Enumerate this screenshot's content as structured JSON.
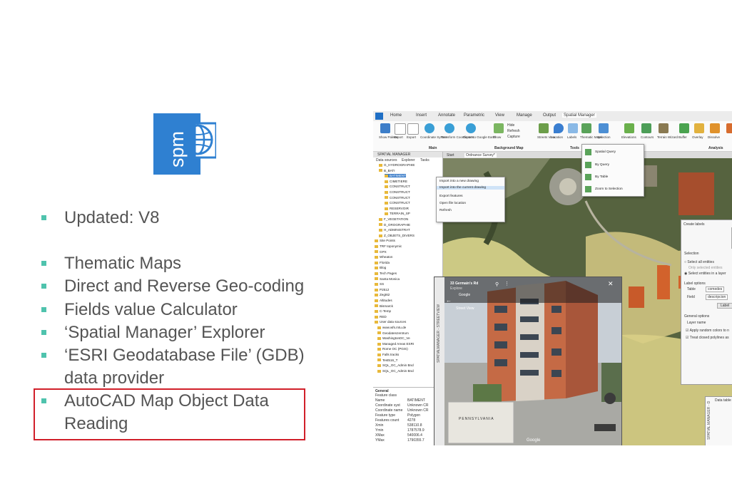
{
  "logo": {
    "text": "spm",
    "icon": "globe-icon",
    "color": "#2f80d1"
  },
  "bullets": [
    "Updated: V8",
    "Thematic Maps",
    "Direct and Reverse Geo-coding",
    "Fields value Calculator",
    "‘Spatial Manager’ Explorer",
    "‘ESRI Geodatabase File’ (GDB)",
    "data provider",
    "AutoCAD Map Object Data",
    "Reading"
  ],
  "app": {
    "tabs": [
      "Home",
      "Insert",
      "Annotate",
      "Parametric",
      "View",
      "Manage",
      "Output",
      "Spatial Manager"
    ],
    "ribbon_buttons": [
      "Show Palette",
      "Import",
      "Export",
      "Coordinate System",
      "Transform Coordinates",
      "Export to Google Earth",
      "Show",
      "Streets View",
      "Location",
      "Labels",
      "Thematic Maps",
      "Selection",
      "Elevations",
      "Contours",
      "Terrain Wizard",
      "Buffer",
      "Overlay",
      "Dissolve"
    ],
    "ribbon_small": [
      "Hide",
      "Refresh",
      "Capture"
    ],
    "ribbon_groups": [
      "Main",
      "Background Map",
      "Tools",
      "Analysis"
    ],
    "panel_title": "SPATIAL MANAGER",
    "panel_tabs": [
      "Data sources",
      "Explorer",
      "Tasks"
    ],
    "doc_tabs": [
      "Start",
      "Ordnance Survey*"
    ],
    "tree": [
      "G_HYDROGRAPHIE",
      "B_BATI",
      "BATIMENT",
      "CIMETIERE",
      "CONSTRUCT",
      "CONSTRUCT",
      "CONSTRUCT",
      "CONSTRUCT",
      "RESERVOIR",
      "TERRAIN_SP",
      "F_VEGETATION",
      "D_OROGRAPHIE",
      "H_ADMINISTRAT",
      "Z_OBJETS_DIVERS",
      "Site Points",
      "TRF toponymic",
      "GPX",
      "Wheaton",
      "Florida",
      "Blog",
      "Tech Pages",
      "Santa Monica",
      "SS",
      "P2512",
      "Zegt62",
      "Altitudes",
      "Bismarck",
      "C-Temp",
      "RED",
      "User data sources",
      "www.wfs.mtu.de",
      "Geodatenzentrum",
      "WashingtonDC_Ve",
      "Managed Areas ESRI",
      "Rome OC (PGIS)",
      "Falls tracks",
      "Test516_T",
      "SQL_OC_Admin Bnd",
      "SQL_OC_Admin Bnd"
    ],
    "context_menu": [
      "Import into a new drawing",
      "Import into the current drawing",
      "Export features",
      "Open file location",
      "Refresh"
    ],
    "thematic_menu": [
      "Spatial Query",
      "By Query",
      "By Table",
      "Zoom to Selection"
    ],
    "props_title": "General",
    "props_sub": "Feature class",
    "props": [
      {
        "k": "Name",
        "v": "BATIMENT"
      },
      {
        "k": "Coordinate syst",
        "v": "Unknown CR"
      },
      {
        "k": "Coordinate name",
        "v": "Unknown CR"
      },
      {
        "k": "Feature type",
        "v": "Polygon"
      },
      {
        "k": "Features count",
        "v": "4278"
      },
      {
        "k": "Xmin",
        "v": "538110.8"
      },
      {
        "k": "Ymin",
        "v": "1787578.9"
      },
      {
        "k": "XMax",
        "v": "540006.4"
      },
      {
        "k": "YMax",
        "v": "1790355.7"
      }
    ],
    "labels_dialog": {
      "title": "Create labels",
      "selection": "Selection",
      "opt1": "Select all entities",
      "opt2": "Only selected entities",
      "opt3": "Select entities in a layer",
      "label_options": "Label options",
      "table": "Table",
      "table_val": "comedes",
      "field": "Field",
      "field_val": "descripcion",
      "label_btn": "Label",
      "general": "General options",
      "layer_name": "Layer name",
      "chk1": "Apply random colors to n",
      "chk2": "Treat closed polylines as"
    },
    "streetview": {
      "address": "33 Germain's Rd",
      "explore": "Explore",
      "provider": "Google",
      "mode": "Street View",
      "map_label": "PENNSYLVANIA",
      "watermark": "Google"
    },
    "side_strip": "SPATIALMANAGER - STREETVIEW",
    "data_table": "Data table",
    "side_strip2": "SPATIAL MANAGER - D"
  }
}
